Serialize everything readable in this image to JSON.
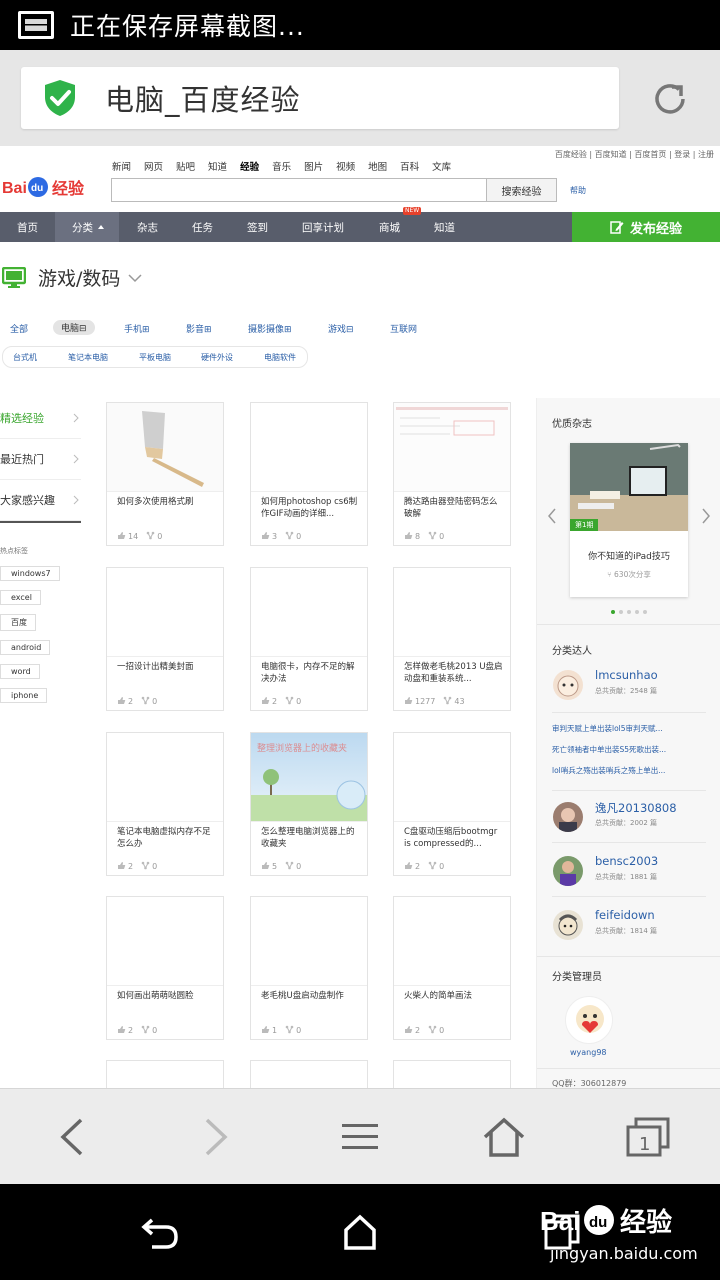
{
  "status_bar": {
    "text": "正在保存屏幕截图..."
  },
  "address_bar": {
    "title": "电脑_百度经验"
  },
  "header": {
    "top_links": "百度经验 | 百度知道 | 百度首页 | 登录 | 注册",
    "logo_text": "Baidu经验",
    "nav_words": [
      "新闻",
      "网页",
      "贴吧",
      "知道",
      "经验",
      "音乐",
      "图片",
      "视频",
      "地图",
      "百科",
      "文库"
    ],
    "search_button": "搜索经验",
    "help": "帮助"
  },
  "main_nav": {
    "items": [
      "首页",
      "分类",
      "杂志",
      "任务",
      "签到",
      "回享计划",
      "商城",
      "知道"
    ],
    "new_badge": "NEW",
    "publish": "发布经验"
  },
  "category": {
    "title": "游戏/数码",
    "subcats": [
      "全部",
      "电脑",
      "手机",
      "影音",
      "摄影摄像",
      "游戏",
      "互联网"
    ],
    "subcat_suffix": "⊟",
    "subsub": [
      "台式机",
      "笔记本电脑",
      "平板电脑",
      "硬件外设",
      "电脑软件"
    ]
  },
  "side_menu": {
    "items": [
      "精选经验",
      "最近热门",
      "大家感兴趣"
    ],
    "hot_label": "热点标签",
    "tags": [
      "windows7",
      "excel",
      "百度",
      "android",
      "word",
      "iphone"
    ]
  },
  "cards": [
    {
      "title": "如何多次使用格式刷",
      "likes": "14",
      "shares": "0",
      "thumb": "brush-image"
    },
    {
      "title": "如何用photoshop cs6制作GIF动画的详细...",
      "likes": "3",
      "shares": "0",
      "thumb": "blank"
    },
    {
      "title": "腾达路由器登陆密码怎么破解",
      "likes": "8",
      "shares": "0",
      "thumb": "screenshot-image"
    },
    {
      "title": "一招设计出精美封面",
      "likes": "2",
      "shares": "0",
      "thumb": "blank"
    },
    {
      "title": "电脑很卡，内存不足的解决办法",
      "likes": "2",
      "shares": "0",
      "thumb": "blank"
    },
    {
      "title": "怎样做老毛桃2013 U盘启动盘和重装系统...",
      "likes": "1277",
      "shares": "43",
      "thumb": "blank"
    },
    {
      "title": "笔记本电脑虚拟内存不足怎么办",
      "likes": "2",
      "shares": "0",
      "thumb": "blank"
    },
    {
      "title": "怎么整理电脑浏览器上的收藏夹",
      "likes": "5",
      "shares": "0",
      "thumb": "landscape-image",
      "thumb_caption": "整理浏览器上的收藏夹"
    },
    {
      "title": "C盘驱动压缩后bootmgr is compressed的...",
      "likes": "2",
      "shares": "0",
      "thumb": "blank"
    },
    {
      "title": "如何画出萌萌哒圆脸",
      "likes": "2",
      "shares": "0",
      "thumb": "blank"
    },
    {
      "title": "老毛桃U盘启动盘制作",
      "likes": "1",
      "shares": "0",
      "thumb": "blank"
    },
    {
      "title": "火柴人的简单画法",
      "likes": "2",
      "shares": "0",
      "thumb": "blank"
    }
  ],
  "right_col": {
    "magazine_title": "优质杂志",
    "magazine": {
      "issue": "第1期",
      "title": "你不知道的iPad技巧",
      "shares": "630次分享"
    },
    "experts_title": "分类达人",
    "experts": [
      {
        "name": "lmcsunhao",
        "contrib": "总共贡献：2548 篇"
      },
      {
        "name": "逸凡20130808",
        "contrib": "总共贡献：2002 篇"
      },
      {
        "name": "bensc2003",
        "contrib": "总共贡献：1881 篇"
      },
      {
        "name": "feifeidown",
        "contrib": "总共贡献：1814 篇"
      }
    ],
    "expert_links": [
      "审判天赋上单出装lol5审判天赋...",
      "死亡领袖者中单出装S5死歌出装...",
      "lol哨兵之殇出装哨兵之殇上单出..."
    ],
    "admin_title": "分类管理员",
    "admin_name": "wyang98",
    "qq": "QQ群：306012879"
  },
  "watermark": {
    "url": "jingyan.baidu.com"
  },
  "colors": {
    "green": "#3aa62e",
    "nav": "#585d6b",
    "link": "#2b5fa7"
  }
}
